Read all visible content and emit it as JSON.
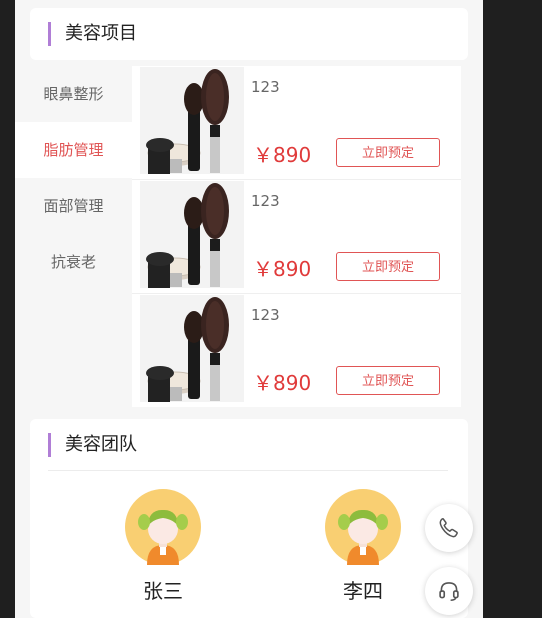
{
  "beauty_section": {
    "title": "美容项目"
  },
  "categories": [
    {
      "label": "眼鼻整形",
      "active": false
    },
    {
      "label": "脂肪管理",
      "active": true
    },
    {
      "label": "面部管理",
      "active": false
    },
    {
      "label": "抗衰老",
      "active": false
    }
  ],
  "products": [
    {
      "name": "123",
      "price": "￥890",
      "button": "立即预定"
    },
    {
      "name": "123",
      "price": "￥890",
      "button": "立即预定"
    },
    {
      "name": "123",
      "price": "￥890",
      "button": "立即预定"
    }
  ],
  "team_section": {
    "title": "美容团队"
  },
  "team": [
    {
      "name": "张三"
    },
    {
      "name": "李四"
    }
  ],
  "colors": {
    "accent": "#e05555",
    "title_bar": "#b07ed6",
    "avatar_bg": "#f9cf72"
  },
  "icons": {
    "phone": "phone-icon",
    "service": "headset-icon"
  }
}
